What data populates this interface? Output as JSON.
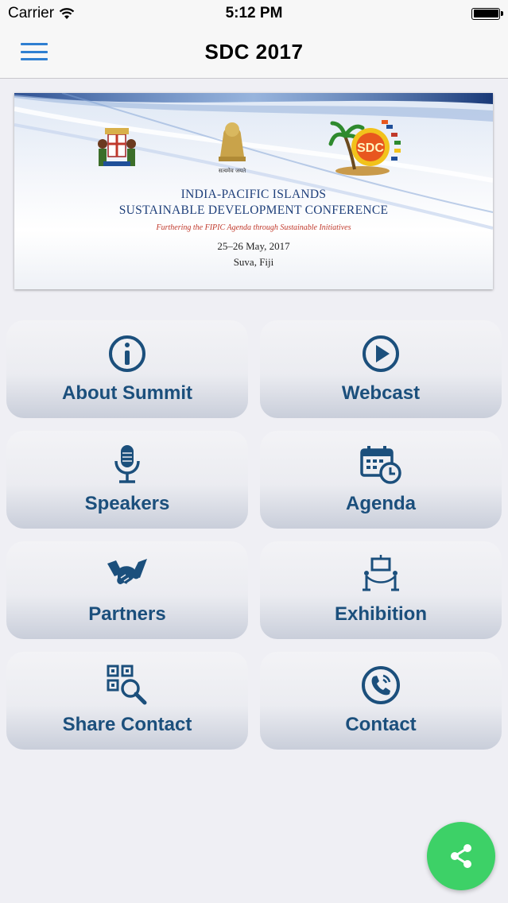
{
  "status_bar": {
    "carrier": "Carrier",
    "time": "5:12 PM"
  },
  "nav": {
    "title": "SDC 2017",
    "menu_icon": "hamburger-menu-icon"
  },
  "banner": {
    "line1": "INDIA-PACIFIC ISLANDS",
    "line2": "SUSTAINABLE DEVELOPMENT CONFERENCE",
    "tagline": "Furthering the FIPIC Agenda through Sustainable Initiatives",
    "dates": "25–26 May, 2017",
    "location": "Suva, Fiji",
    "logo_text": "SDC"
  },
  "tiles": [
    {
      "label": "About Summit",
      "icon": "info-icon"
    },
    {
      "label": "Webcast",
      "icon": "play-icon"
    },
    {
      "label": "Speakers",
      "icon": "microphone-icon"
    },
    {
      "label": "Agenda",
      "icon": "calendar-clock-icon"
    },
    {
      "label": "Partners",
      "icon": "handshake-icon"
    },
    {
      "label": "Exhibition",
      "icon": "exhibition-stand-icon"
    },
    {
      "label": "Share Contact",
      "icon": "qr-search-icon"
    },
    {
      "label": "Contact",
      "icon": "phone-icon"
    }
  ],
  "fab": {
    "icon": "share-icon"
  },
  "colors": {
    "accent": "#1b4f7c",
    "menu": "#2f7fd1",
    "fab": "#3dd167",
    "background": "#efeff4"
  }
}
